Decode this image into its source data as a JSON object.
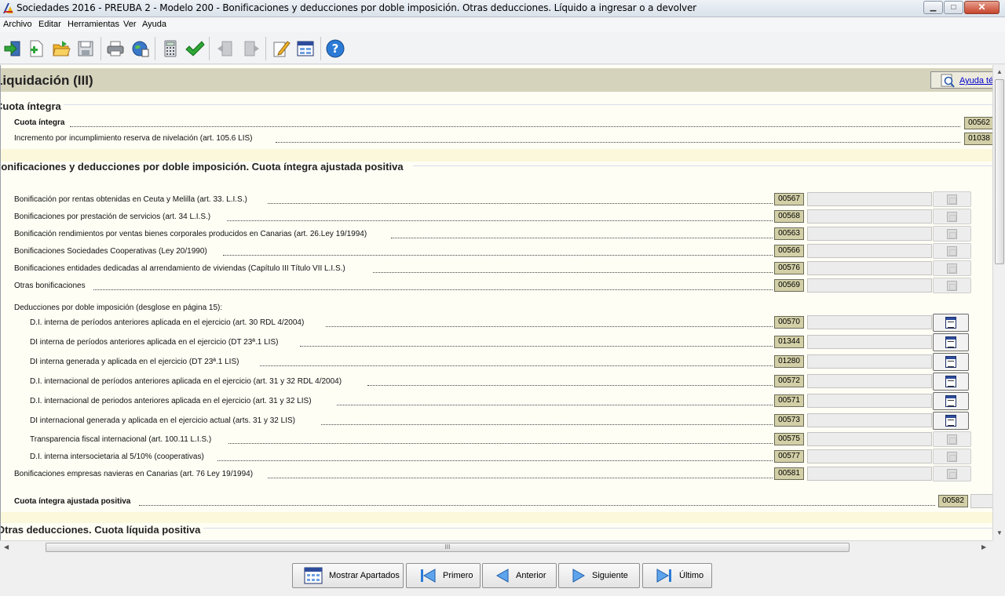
{
  "window": {
    "title": "Sociedades 2016 - PREUBA 2 - Modelo 200 - Bonificaciones y deducciones por doble imposición. Otras deducciones. Líquido a ingresar o a devolver",
    "min": "▁",
    "max": "□",
    "close": "✕"
  },
  "menu": [
    "Archivo",
    "Editar",
    "Herramientas",
    "Ver",
    "Ayuda"
  ],
  "toolbar_icons": [
    "import-icon",
    "new-icon",
    "open-icon",
    "save-icon",
    "print-icon",
    "internet-icon",
    "calculator-icon",
    "validate-check-icon",
    "prev-page-icon",
    "next-page-icon",
    "edit-icon",
    "sections-icon",
    "help-icon"
  ],
  "page": {
    "title": "Liquidación (III)",
    "help_link": "Ayuda té"
  },
  "section_cuota": {
    "title": "Cuota íntegra",
    "rows": [
      {
        "label": "Cuota íntegra",
        "code": "00562",
        "bold": true
      },
      {
        "label": "Incremento por incumplimiento reserva de nivelación (art. 105.6 LIS)",
        "code": "01038",
        "bold": false
      }
    ]
  },
  "section_bonif": {
    "title": "Bonificaciones y deducciones por doble imposición. Cuota íntegra ajustada positiva",
    "bonificaciones": [
      {
        "label": "Bonificación por rentas obtenidas en Ceuta y Melilla (art. 33. L.I.S.)",
        "code": "00567"
      },
      {
        "label": "Bonificaciones por prestación de servicios (art. 34 L.I.S.)",
        "code": "00568"
      },
      {
        "label": "Bonificación rendimientos por ventas bienes corporales producidos en Canarias (art. 26.Ley 19/1994)",
        "code": "00563"
      },
      {
        "label": "Bonificaciones Sociedades Cooperativas (Ley 20/1990)",
        "code": "00566"
      },
      {
        "label": "Bonificaciones entidades dedicadas al arrendamiento de viviendas (Capítulo III Título VII L.I.S.)",
        "code": "00576"
      },
      {
        "label": "Otras bonificaciones",
        "code": "00569"
      }
    ],
    "deducciones_heading": "Deducciones por doble imposición (desglose en página 15):",
    "deducciones": [
      {
        "label": "D.I. interna de períodos anteriores aplicada en el ejercicio (art. 30 RDL 4/2004)",
        "code": "00570",
        "active": true
      },
      {
        "label": "DI interna de períodos anteriores aplicada en el ejercicio (DT 23ª.1 LIS)",
        "code": "01344",
        "active": true
      },
      {
        "label": "DI interna generada y aplicada en el ejercicio (DT 23ª.1 LIS)",
        "code": "01280",
        "active": true
      },
      {
        "label": "D.I. internacional de períodos anteriores aplicada en el ejercicio (art. 31 y 32 RDL 4/2004)",
        "code": "00572",
        "active": true
      },
      {
        "label": "D.I. internacional de periodos anteriores aplicada en el ejercicio (art. 31 y 32 LIS)",
        "code": "00571",
        "active": true
      },
      {
        "label": "DI internacional generada y aplicada en el ejercicio actual (arts. 31 y 32 LIS)",
        "code": "00573",
        "active": true
      },
      {
        "label": "Transparencia fiscal internacional (art. 100.11 L.I.S.)",
        "code": "00575",
        "active": false
      },
      {
        "label": "D.I. interna intersocietaria al 5/10% (cooperativas)",
        "code": "00577",
        "active": false
      }
    ],
    "navieras": {
      "label": "Bonificaciones empresas navieras en Canarias (art. 76 Ley 19/1994)",
      "code": "00581"
    },
    "total": {
      "label": "Cuota íntegra ajustada positiva",
      "code": "00582"
    }
  },
  "section_otras": {
    "title": "Otras deducciones. Cuota líquida positiva"
  },
  "scrollbar": {
    "grip": "III"
  },
  "nav": [
    {
      "label": "Mostrar Apartados",
      "icon": "sections-icon"
    },
    {
      "label": "Primero",
      "icon": "first-icon"
    },
    {
      "label": "Anterior",
      "icon": "previous-icon"
    },
    {
      "label": "Siguiente",
      "icon": "next-icon"
    },
    {
      "label": "Último",
      "icon": "last-icon"
    }
  ]
}
